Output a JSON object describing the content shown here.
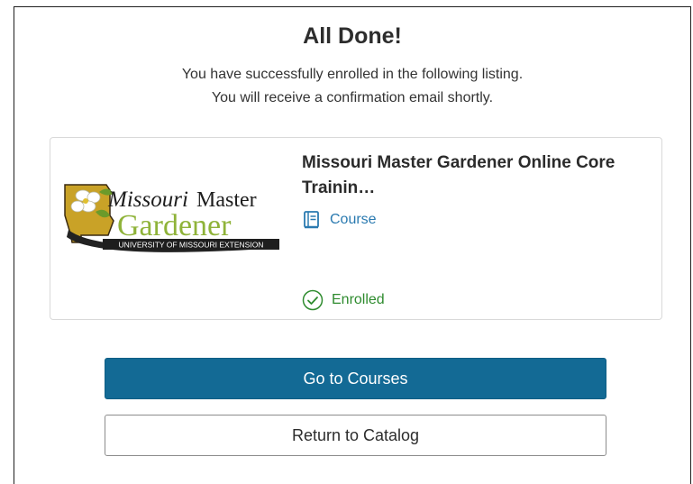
{
  "dialog": {
    "title": "All Done!",
    "message_line1": "You have successfully enrolled in the following listing.",
    "message_line2": "You will receive a confirmation email shortly."
  },
  "listing": {
    "title_line1": "Missouri Master Gardener Online Core",
    "title_line2": "Trainin…",
    "type_label": "Course",
    "type_icon": "book-icon",
    "status_label": "Enrolled",
    "status_icon": "check-circle-icon",
    "logo": {
      "line1_a": "Missouri",
      "line1_b": "Master",
      "line2": "Gardener",
      "bar": "UNIVERSITY OF MISSOURI EXTENSION"
    }
  },
  "actions": {
    "primary_label": "Go to Courses",
    "secondary_label": "Return to Catalog"
  },
  "colors": {
    "primary": "#136a95",
    "link": "#2a7ab0",
    "success": "#2e8b2e",
    "logo_gold": "#c9a227",
    "logo_green": "#8fb339"
  }
}
